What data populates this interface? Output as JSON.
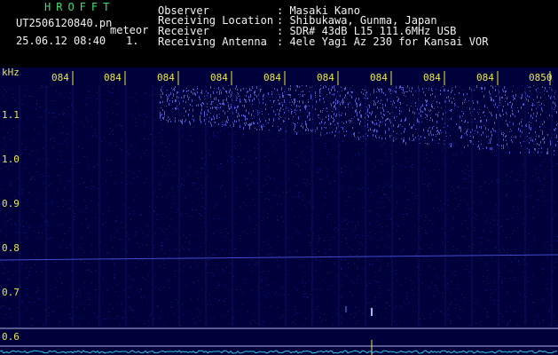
{
  "header": {
    "app_title": "HROFFT",
    "file_name": "UT2506120840.pn",
    "mode": "meteor",
    "date_time": "25.06.12 08:40",
    "frame": "1.",
    "fields": [
      {
        "label": "Observer",
        "value": ": Masaki Kano"
      },
      {
        "label": "Receiving Location",
        "value": ": Shibukawa, Gunma, Japan"
      },
      {
        "label": "Receiver",
        "value": ": SDR# 43dB L15 111.6MHz USB"
      },
      {
        "label": "Receiving Antenna",
        "value": ": 4ele Yagi Az 230 for Kansai VOR"
      }
    ]
  },
  "spectrogram": {
    "freq_unit": "kHz",
    "freq_ticks": [
      "1.1",
      "1.0",
      "0.9",
      "0.8",
      "0.7",
      "0.6"
    ],
    "time_ticks": [
      "084",
      "084",
      "084",
      "084",
      "084",
      "084",
      "084",
      "084",
      "084",
      "0850"
    ],
    "colors": {
      "background": "#00003a",
      "noise": "#1e2cb4",
      "signal": "#6a7cff",
      "axis_text": "#e8e84a",
      "guide_line": "#aeb4e6",
      "amplitude": "#27c7e6"
    }
  }
}
